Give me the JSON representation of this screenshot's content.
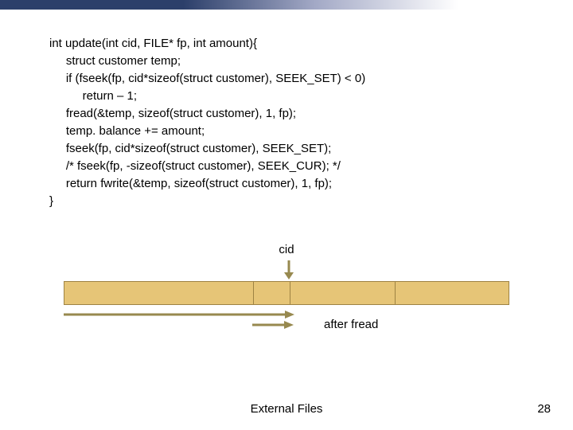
{
  "code": {
    "l1": "int update(int cid, FILE* fp, int amount){",
    "l2": "     struct customer temp;",
    "l3": "     if (fseek(fp, cid*sizeof(struct customer), SEEK_SET) < 0)",
    "l4": "          return – 1;",
    "l5": "     fread(&temp, sizeof(struct customer), 1, fp);",
    "l6": "     temp. balance += amount;",
    "l7": "     fseek(fp, cid*sizeof(struct customer), SEEK_SET);",
    "l8": "     /* fseek(fp, -sizeof(struct customer), SEEK_CUR); */",
    "l9": "     return fwrite(&temp, sizeof(struct customer), 1, fp);",
    "l10": "}"
  },
  "diagram": {
    "cid_label": "cid",
    "after_label": "after fread"
  },
  "footer": {
    "title": "External Files",
    "page": "28"
  }
}
